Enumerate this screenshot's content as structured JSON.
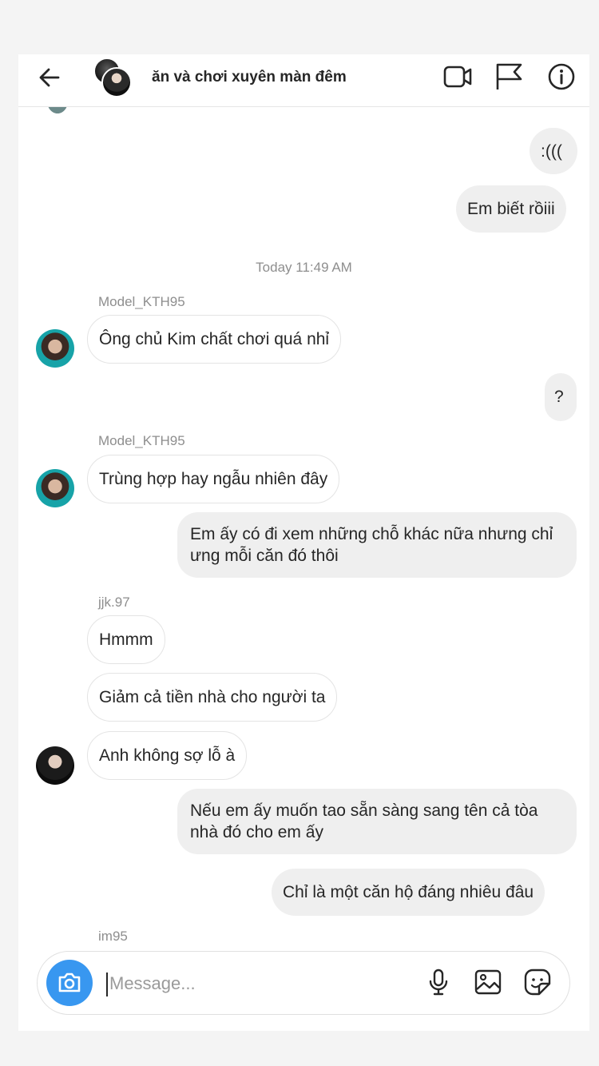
{
  "header": {
    "title": "ăn và chơi xuyên màn đêm"
  },
  "messages": {
    "m1": ":(((",
    "m2": "Em biết rồiii",
    "timestamp": "Today 11:49 AM",
    "s1": "Model_KTH95",
    "m3": "Ông chủ Kim chất chơi quá nhỉ",
    "m4": "?",
    "s2": "Model_KTH95",
    "m5": "Trùng hợp hay ngẫu nhiên đây",
    "m6": "Em ấy có đi xem những chỗ khác nữa nhưng chỉ ưng mỗi căn đó thôi",
    "s3": "jjk.97",
    "m7": "Hmmm",
    "m8": "Giảm cả tiền nhà cho người ta",
    "m9": "Anh không sợ lỗ à",
    "m10": "Nếu em ấy muốn tao sẵn sàng sang tên cả tòa nhà đó cho em ấy",
    "m11": "Chỉ là một căn hộ đáng nhiêu đâu",
    "s4": "im95"
  },
  "composer": {
    "placeholder": "Message..."
  },
  "icons": {
    "back": "arrow-left-icon",
    "video": "video-camera-icon",
    "flag": "flag-icon",
    "info": "info-icon",
    "camera": "camera-icon",
    "mic": "microphone-icon",
    "gallery": "image-icon",
    "sticker": "sticker-icon"
  },
  "colors": {
    "accent": "#3897f0",
    "bubble_out": "#efefef",
    "muted_text": "#8e8e8e"
  }
}
